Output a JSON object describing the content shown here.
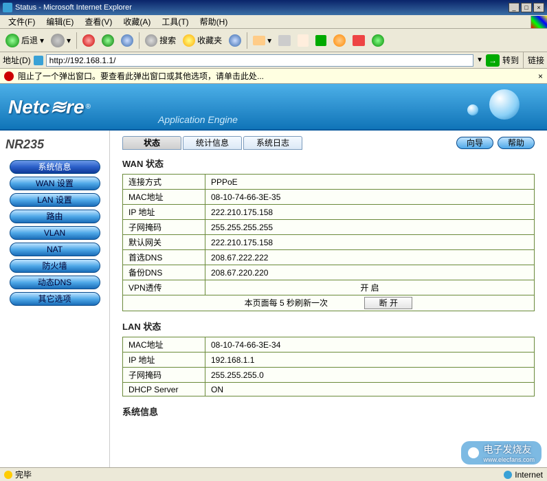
{
  "window": {
    "title": "Status - Microsoft Internet Explorer"
  },
  "menubar": {
    "items": [
      "文件(F)",
      "编辑(E)",
      "查看(V)",
      "收藏(A)",
      "工具(T)",
      "帮助(H)"
    ]
  },
  "toolbar": {
    "back": "后退",
    "search": "搜索",
    "favorites": "收藏夹"
  },
  "addressbar": {
    "label": "地址(D)",
    "url": "http://192.168.1.1/",
    "go": "转到",
    "links": "链接"
  },
  "infobar": {
    "text": "阻止了一个弹出窗口。要查看此弹出窗口或其他选项，请单击此处..."
  },
  "banner": {
    "brand": "Netc≋re",
    "sub": "Application Engine",
    "reg": "®"
  },
  "sidebar": {
    "model": "NR235",
    "items": [
      {
        "label": "系统信息",
        "active": true
      },
      {
        "label": "WAN 设置"
      },
      {
        "label": "LAN 设置"
      },
      {
        "label": "路由"
      },
      {
        "label": "VLAN"
      },
      {
        "label": "NAT"
      },
      {
        "label": "防火墙"
      },
      {
        "label": "动态DNS"
      },
      {
        "label": "其它选项"
      }
    ]
  },
  "tabs": {
    "items": [
      {
        "label": "状态",
        "active": true
      },
      {
        "label": "统计信息"
      },
      {
        "label": "系统日志"
      }
    ],
    "wizard": "向导",
    "help": "帮助"
  },
  "sections": {
    "wan": {
      "title": "WAN 状态",
      "rows": [
        {
          "k": "连接方式",
          "v": "PPPoE"
        },
        {
          "k": "MAC地址",
          "v": "08-10-74-66-3E-35"
        },
        {
          "k": "IP   地址",
          "v": "222.210.175.158"
        },
        {
          "k": "子网掩码",
          "v": "255.255.255.255"
        },
        {
          "k": "默认网关",
          "v": "222.210.175.158"
        },
        {
          "k": "首选DNS",
          "v": "208.67.222.222"
        },
        {
          "k": "备份DNS",
          "v": "208.67.220.220"
        },
        {
          "k": "VPN透传",
          "v": "开  启"
        }
      ],
      "refresh_hint": "本页面每  5 秒刷新一次",
      "disconnect": "断 开"
    },
    "lan": {
      "title": "LAN 状态",
      "rows": [
        {
          "k": "MAC地址",
          "v": "08-10-74-66-3E-34"
        },
        {
          "k": "IP   地址",
          "v": "192.168.1.1"
        },
        {
          "k": "子网掩码",
          "v": "255.255.255.0"
        },
        {
          "k": "DHCP Server",
          "v": "ON"
        }
      ]
    },
    "sys": {
      "title": "系统信息"
    }
  },
  "statusbar": {
    "done": "完毕",
    "zone": "Internet"
  },
  "watermark": {
    "text": "电子发烧友",
    "url": "www.elecfans.com"
  }
}
